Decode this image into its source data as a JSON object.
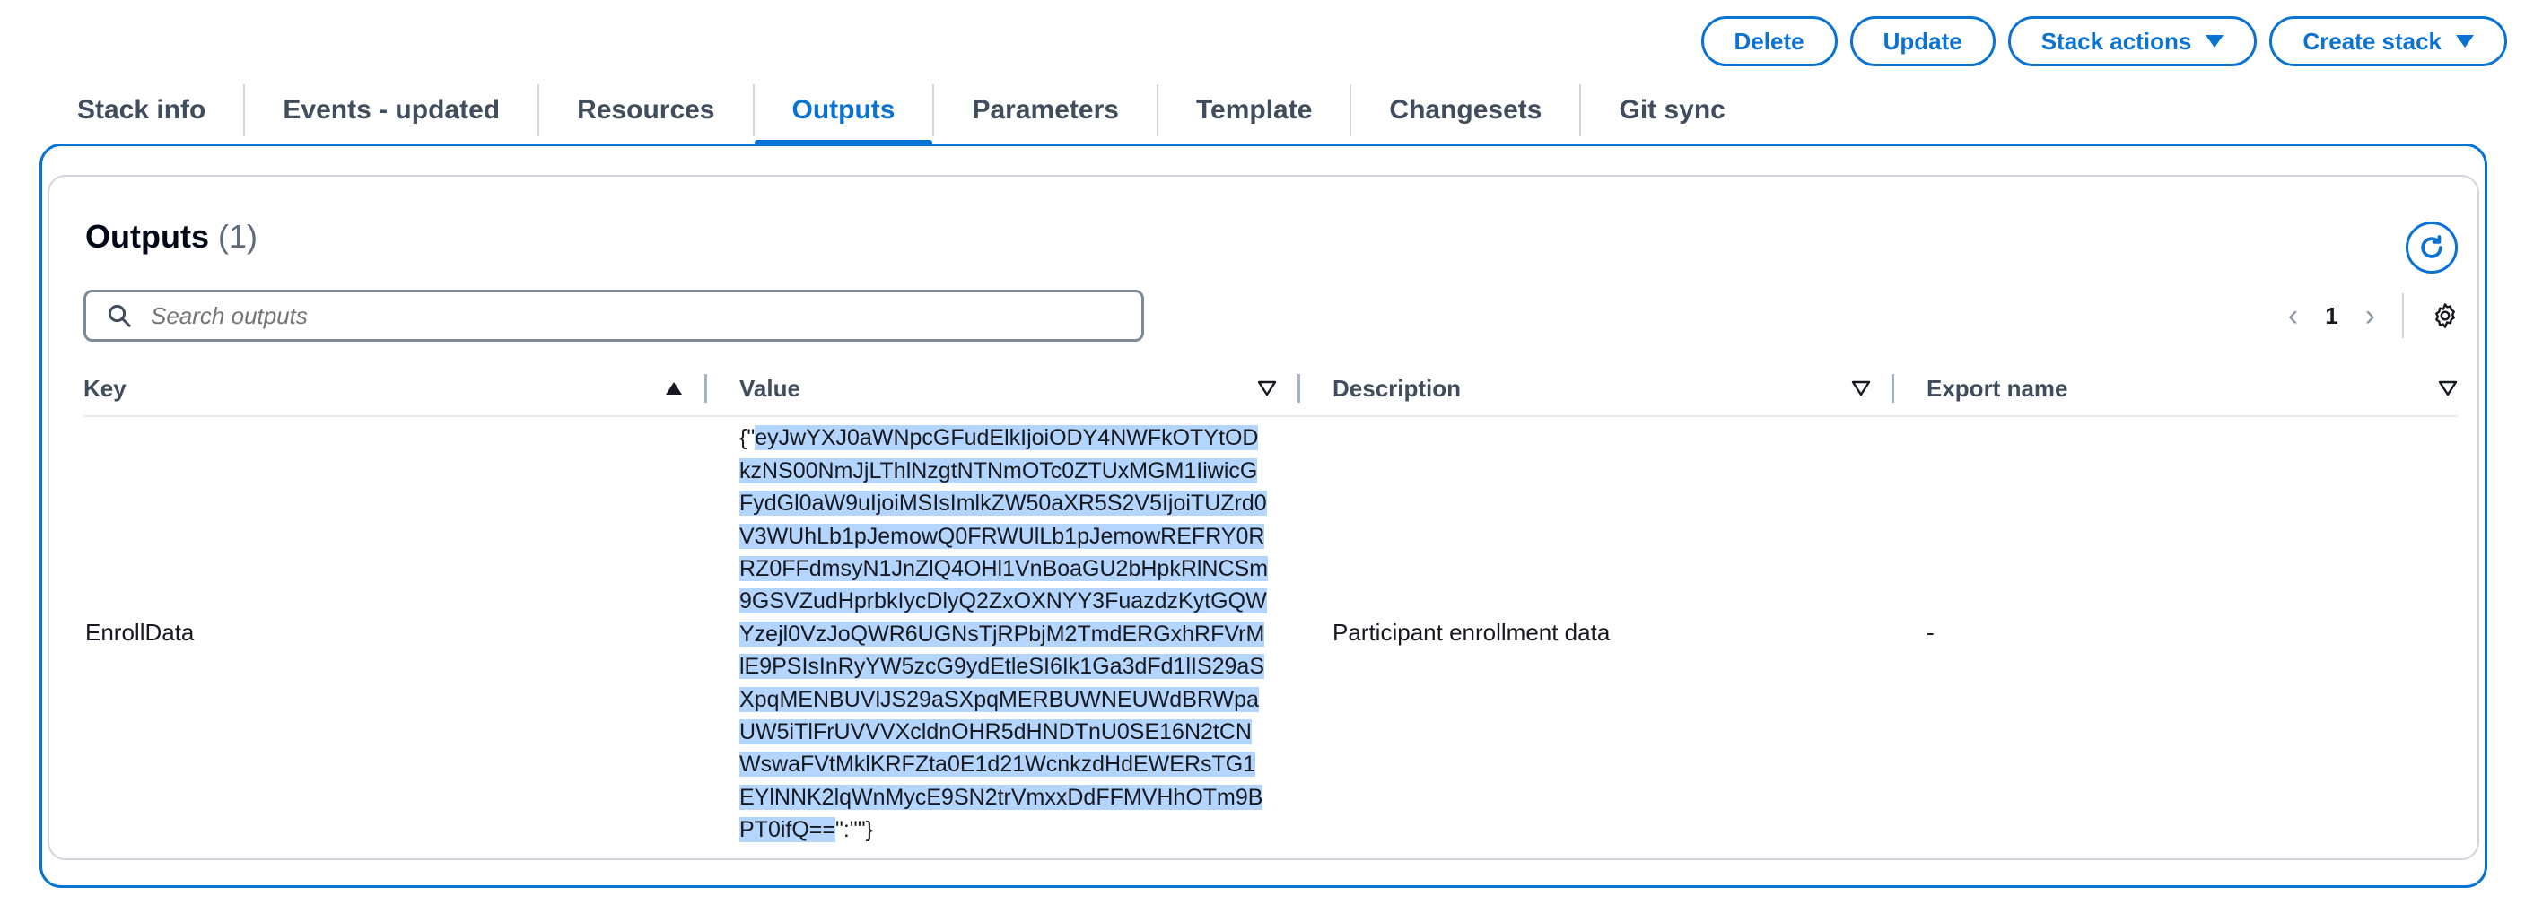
{
  "actions": {
    "delete": "Delete",
    "update": "Update",
    "stack_actions": "Stack actions",
    "create_stack": "Create stack"
  },
  "tabs": [
    {
      "label": "Stack info"
    },
    {
      "label": "Events - updated"
    },
    {
      "label": "Resources"
    },
    {
      "label": "Outputs",
      "active": true
    },
    {
      "label": "Parameters"
    },
    {
      "label": "Template"
    },
    {
      "label": "Changesets"
    },
    {
      "label": "Git sync"
    }
  ],
  "panel": {
    "title": "Outputs",
    "count": "(1)",
    "search_placeholder": "Search outputs",
    "page": "1"
  },
  "table": {
    "headers": [
      "Key",
      "Value",
      "Description",
      "Export name"
    ],
    "rows": [
      {
        "key": "EnrollData",
        "value_prefix": "{\"",
        "value_selected": "eyJwYXJ0aWNpcGFudElkIjoiODY4NWFkOTYtODkzNS00NmJjLThlNzgtNTNmOTc0ZTUxMGM1IiwicGFydGl0aW9uIjoiMSIsImlkZW50aXR5S2V5IjoiTUZrd0V3WUhLb1pJemowQ0FRWUlLb1pJemowREFRY0RRZ0FFdmsyN1JnZlQ4OHl1VnBoaGU2bHpkRlNCSm9GSVZudHprbkIycDlyQ2ZxOXNYY3FuazdzKytGQWYzejl0VzJoQWR6UGNsTjRPbjM2TmdERGxhRFVrMlE9PSIsInRyYW5zcG9ydEtleSI6Ik1Ga3dFd1lIS29aSXpqMENBUVlJS29aSXpqMERBUWNEUWdBRWpaUW5iTlFrUVVVXcldnOHR5dHNDTnU0SE16N2tCNWswaFVtMklKRFZta0E1d21WcnkzdHdEWERsTG1EYlNNK2lqWnMycE9SN2trVmxxDdFFMVHhOTm9BPT0ifQ==",
        "value_suffix": "\":\"\"}",
        "description": "Participant enrollment data",
        "export_name": "-"
      }
    ]
  },
  "colors": {
    "accent": "#0972d3",
    "selection": "#b4d5fe"
  }
}
